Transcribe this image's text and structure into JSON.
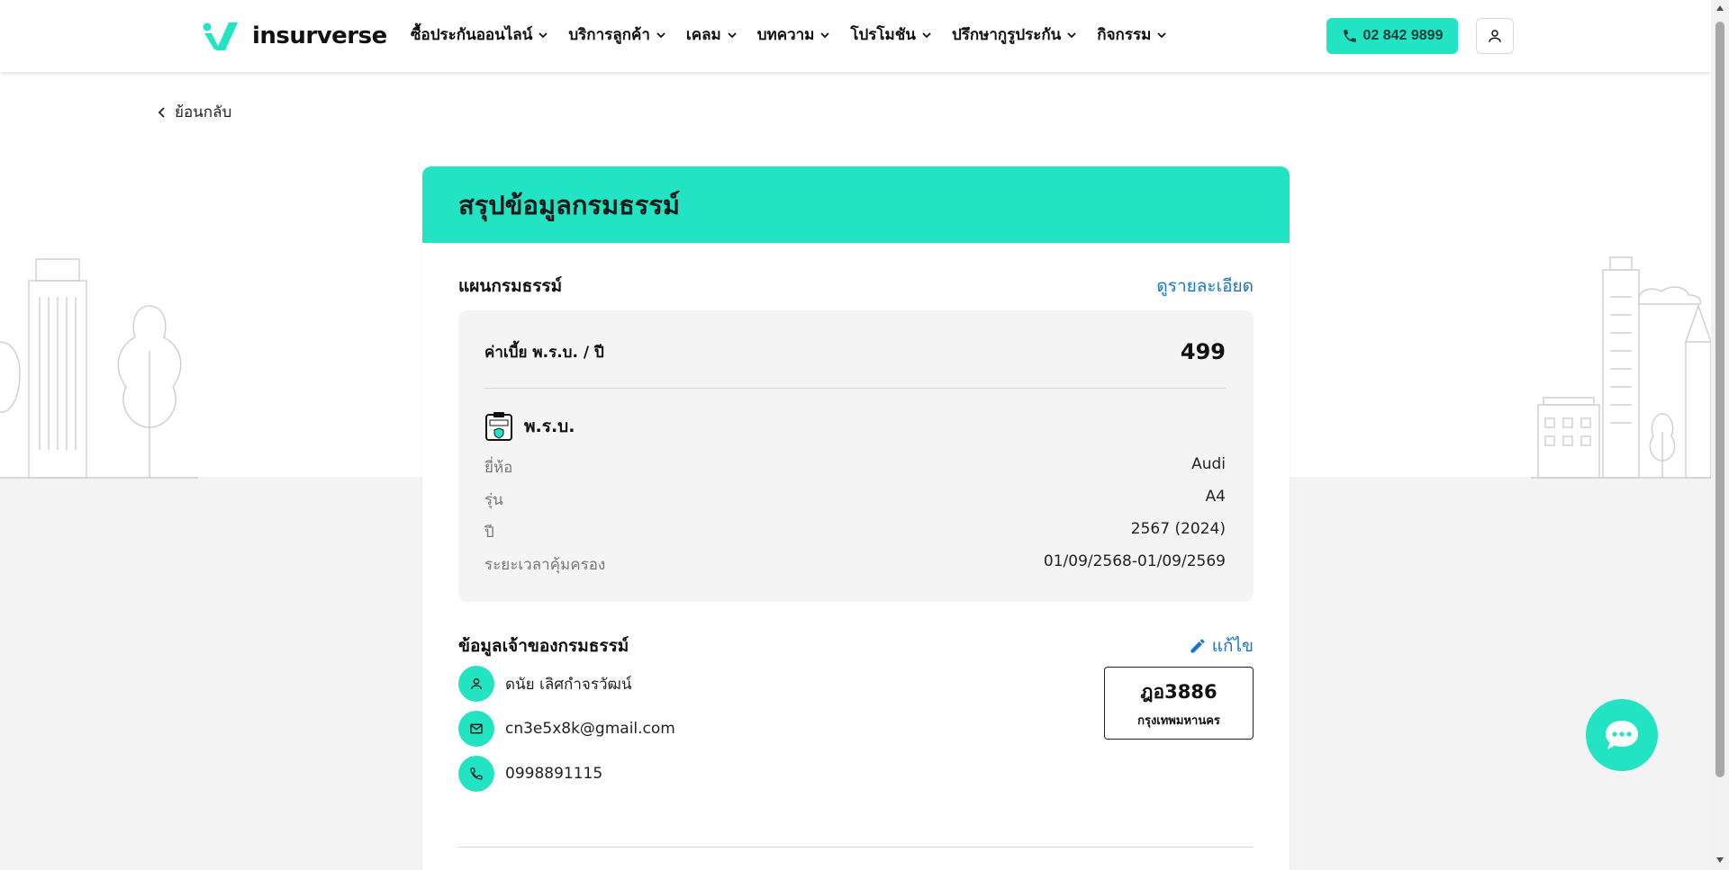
{
  "header": {
    "brand": "insurverse",
    "nav": [
      {
        "label": "ซื้อประกันออนไลน์"
      },
      {
        "label": "บริการลูกค้า"
      },
      {
        "label": "เคลม"
      },
      {
        "label": "บทความ"
      },
      {
        "label": "โปรโมชัน"
      },
      {
        "label": "ปรึกษากูรูประกัน"
      },
      {
        "label": "กิจกรรม"
      }
    ],
    "phone": "02 842 9899"
  },
  "back_label": "ย้อนกลับ",
  "summary": {
    "title": "สรุปข้อมูลกรมธรรม์",
    "plan_section_title": "แผนกรมธรรม์",
    "details_link": "ดูรายละเอียด",
    "premium_label": "ค่าเบี้ย พ.ร.บ. / ปี",
    "premium_value": "499",
    "product_name": "พ.ร.บ.",
    "details": [
      {
        "label": "ยี่ห้อ",
        "value": "Audi"
      },
      {
        "label": "รุ่น",
        "value": "A4"
      },
      {
        "label": "ปี",
        "value": "2567 (2024)"
      },
      {
        "label": "ระยะเวลาคุ้มครอง",
        "value": "01/09/2568-01/09/2569"
      }
    ],
    "owner_section_title": "ข้อมูลเจ้าของกรมธรรม์",
    "edit_link": "แก้ไข",
    "owner": {
      "name": "ดนัย เลิศกำจรวัฒน์",
      "email": "cn3e5x8k@gmail.com",
      "phone": "0998891115"
    },
    "plate": {
      "number": "ฎอ3886",
      "province": "กรุงเทพมหานคร"
    }
  },
  "colors": {
    "accent": "#22e4c2",
    "link": "#1a73c8"
  },
  "icons": [
    "phone-icon",
    "user-icon",
    "chevron-left-icon",
    "chevron-down-icon",
    "certificate-icon",
    "pencil-icon",
    "person-icon",
    "mail-icon",
    "chat-icon"
  ]
}
